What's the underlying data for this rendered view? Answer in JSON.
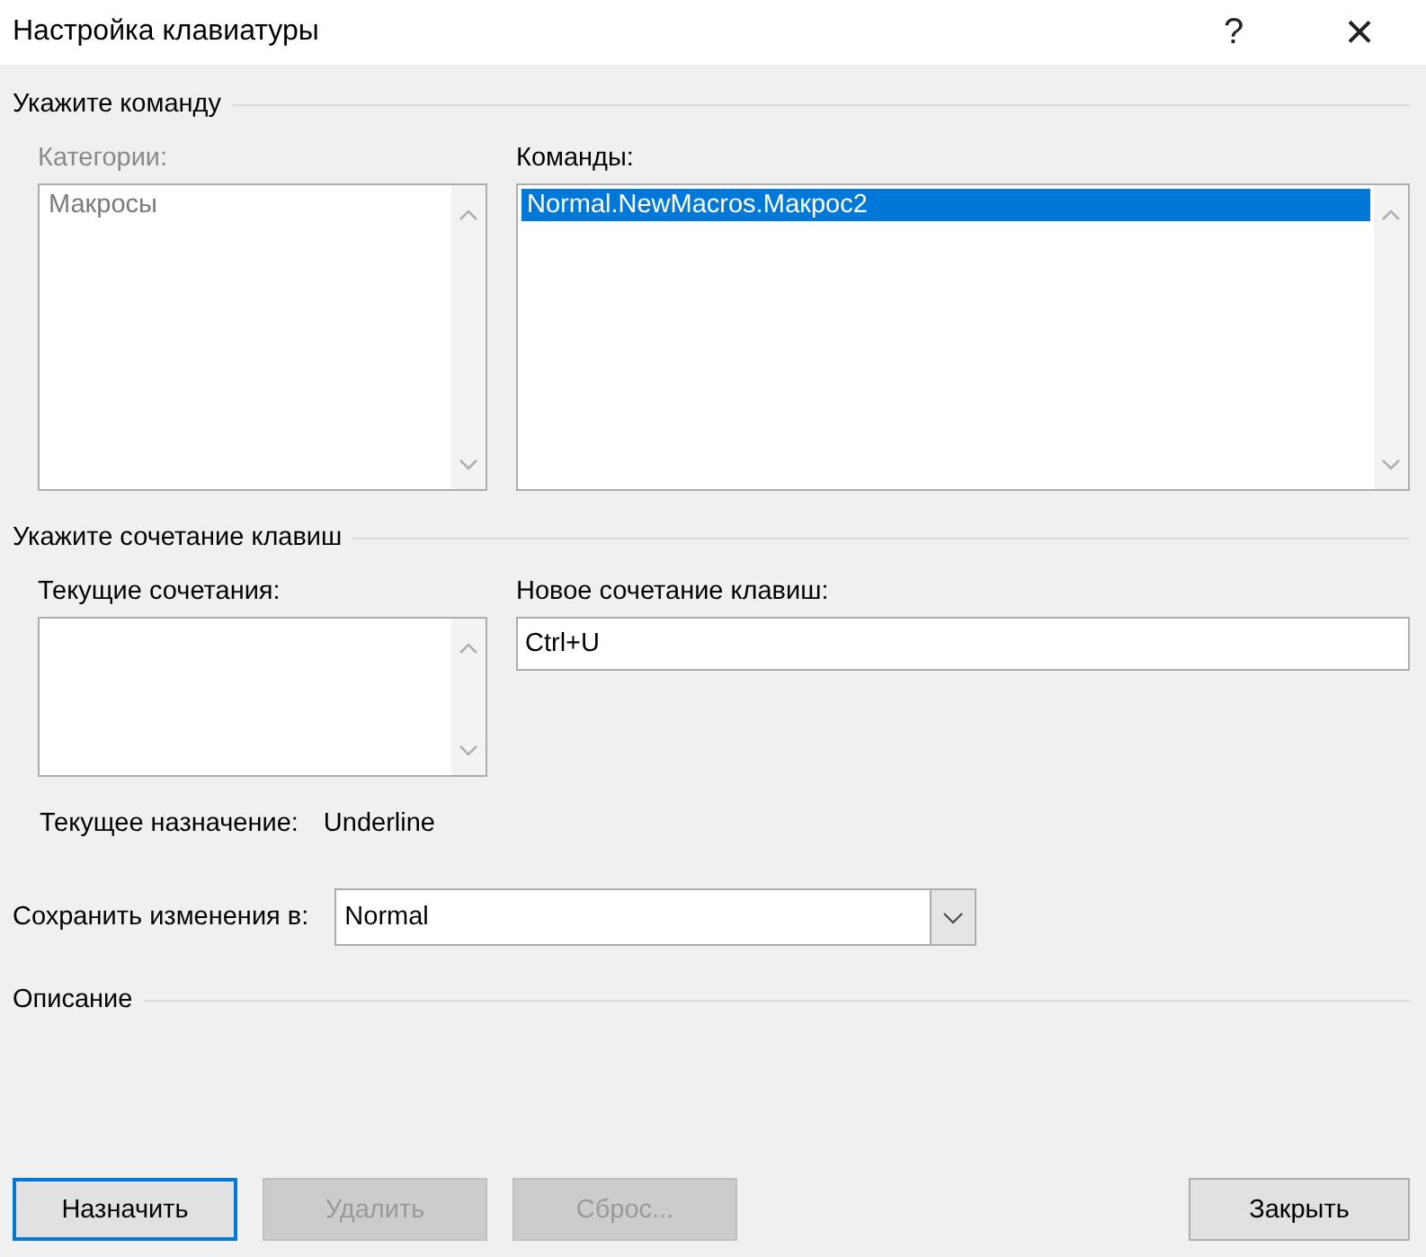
{
  "window": {
    "title": "Настройка клавиатуры",
    "help": "?",
    "close": "×"
  },
  "command_section": {
    "heading": "Укажите команду",
    "categories": {
      "label": "Категории:",
      "disabled": true,
      "items": [
        {
          "text": "Макросы",
          "selected": false
        }
      ]
    },
    "commands": {
      "label": "Команды:",
      "disabled": false,
      "items": [
        {
          "text": "Normal.NewMacros.Макрос2",
          "selected": true
        }
      ]
    }
  },
  "shortcut_section": {
    "heading": "Укажите сочетание клавиш",
    "current_keys": {
      "label": "Текущие сочетания:"
    },
    "new_key": {
      "label": "Новое сочетание клавиш:",
      "value": "Ctrl+U"
    },
    "current_assignment": {
      "label": "Текущее назначение:",
      "value": "Underline"
    }
  },
  "save_in": {
    "label": "Сохранить изменения в:",
    "value": "Normal"
  },
  "description": {
    "heading": "Описание"
  },
  "buttons": [
    {
      "label": "Назначить",
      "disabled": false,
      "default": true
    },
    {
      "label": "Удалить",
      "disabled": true,
      "default": false
    },
    {
      "label": "Сброс...",
      "disabled": true,
      "default": false
    },
    {
      "label": "Закрыть",
      "disabled": false,
      "default": false
    }
  ]
}
